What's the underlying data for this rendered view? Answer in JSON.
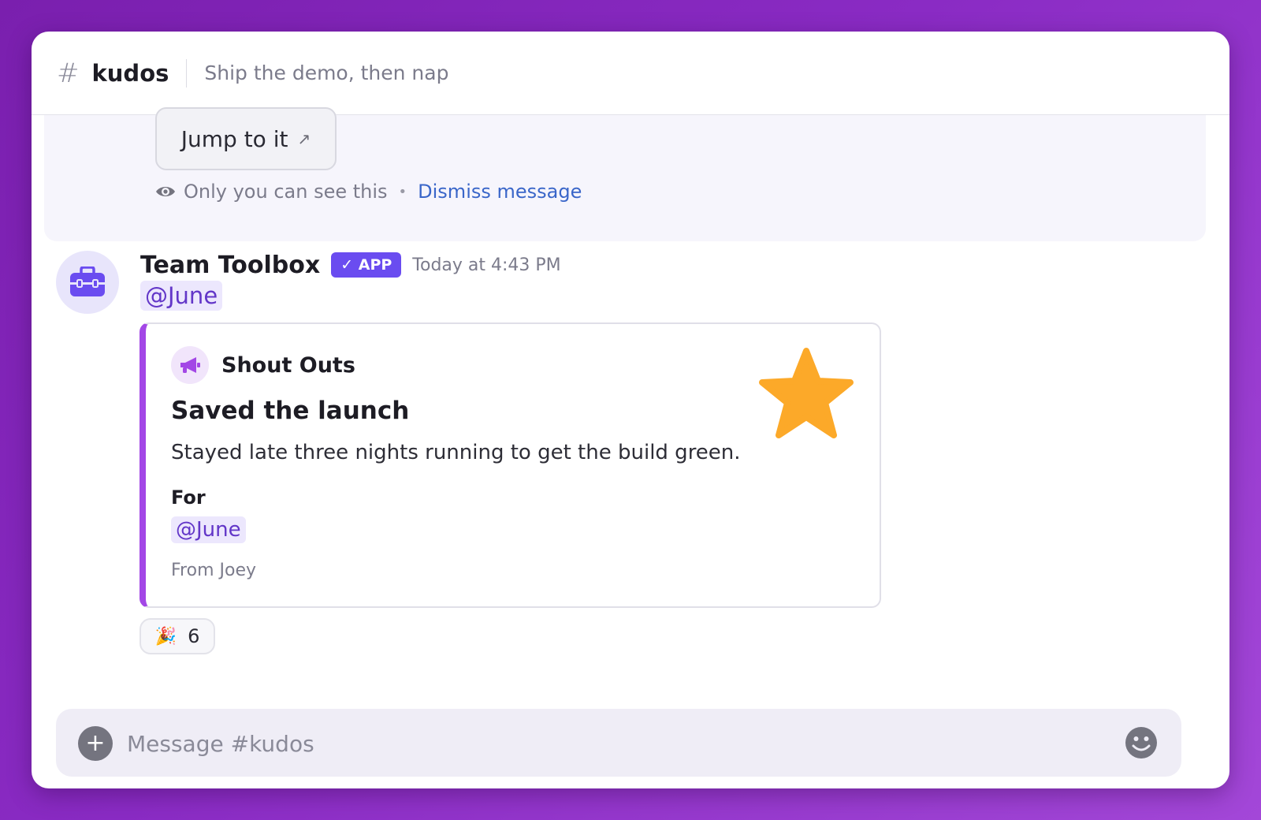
{
  "header": {
    "hash": "#",
    "channel": "kudos",
    "topic": "Ship the demo, then nap"
  },
  "ephemeral": {
    "jump_label": "Jump to it",
    "jump_arrow": "↗",
    "visibility_note": "Only you can see this",
    "separator": "•",
    "dismiss_label": "Dismiss message"
  },
  "message": {
    "sender": "Team Toolbox",
    "badge": "✓ APP",
    "timestamp": "Today at 4:43 PM",
    "mention": "@June",
    "avatar_icon": "toolbox-icon"
  },
  "card": {
    "source_name": "Shout Outs",
    "source_icon": "megaphone-icon",
    "title": "Saved the launch",
    "body": "Stayed late three nights running to get the build green.",
    "for_label": "For",
    "for_mention": "@June",
    "from": "From Joey",
    "accent_color": "#a347e6",
    "image_icon": "star-icon"
  },
  "reaction": {
    "emoji": "🎉",
    "count": "6"
  },
  "composer": {
    "placeholder": "Message #kudos",
    "plus_label": "+"
  },
  "colors": {
    "badge": "#6a4cf0",
    "mention_text": "#6236c8",
    "mention_bg": "#ece7fd",
    "link": "#3a66c9",
    "star": "#fca929"
  }
}
